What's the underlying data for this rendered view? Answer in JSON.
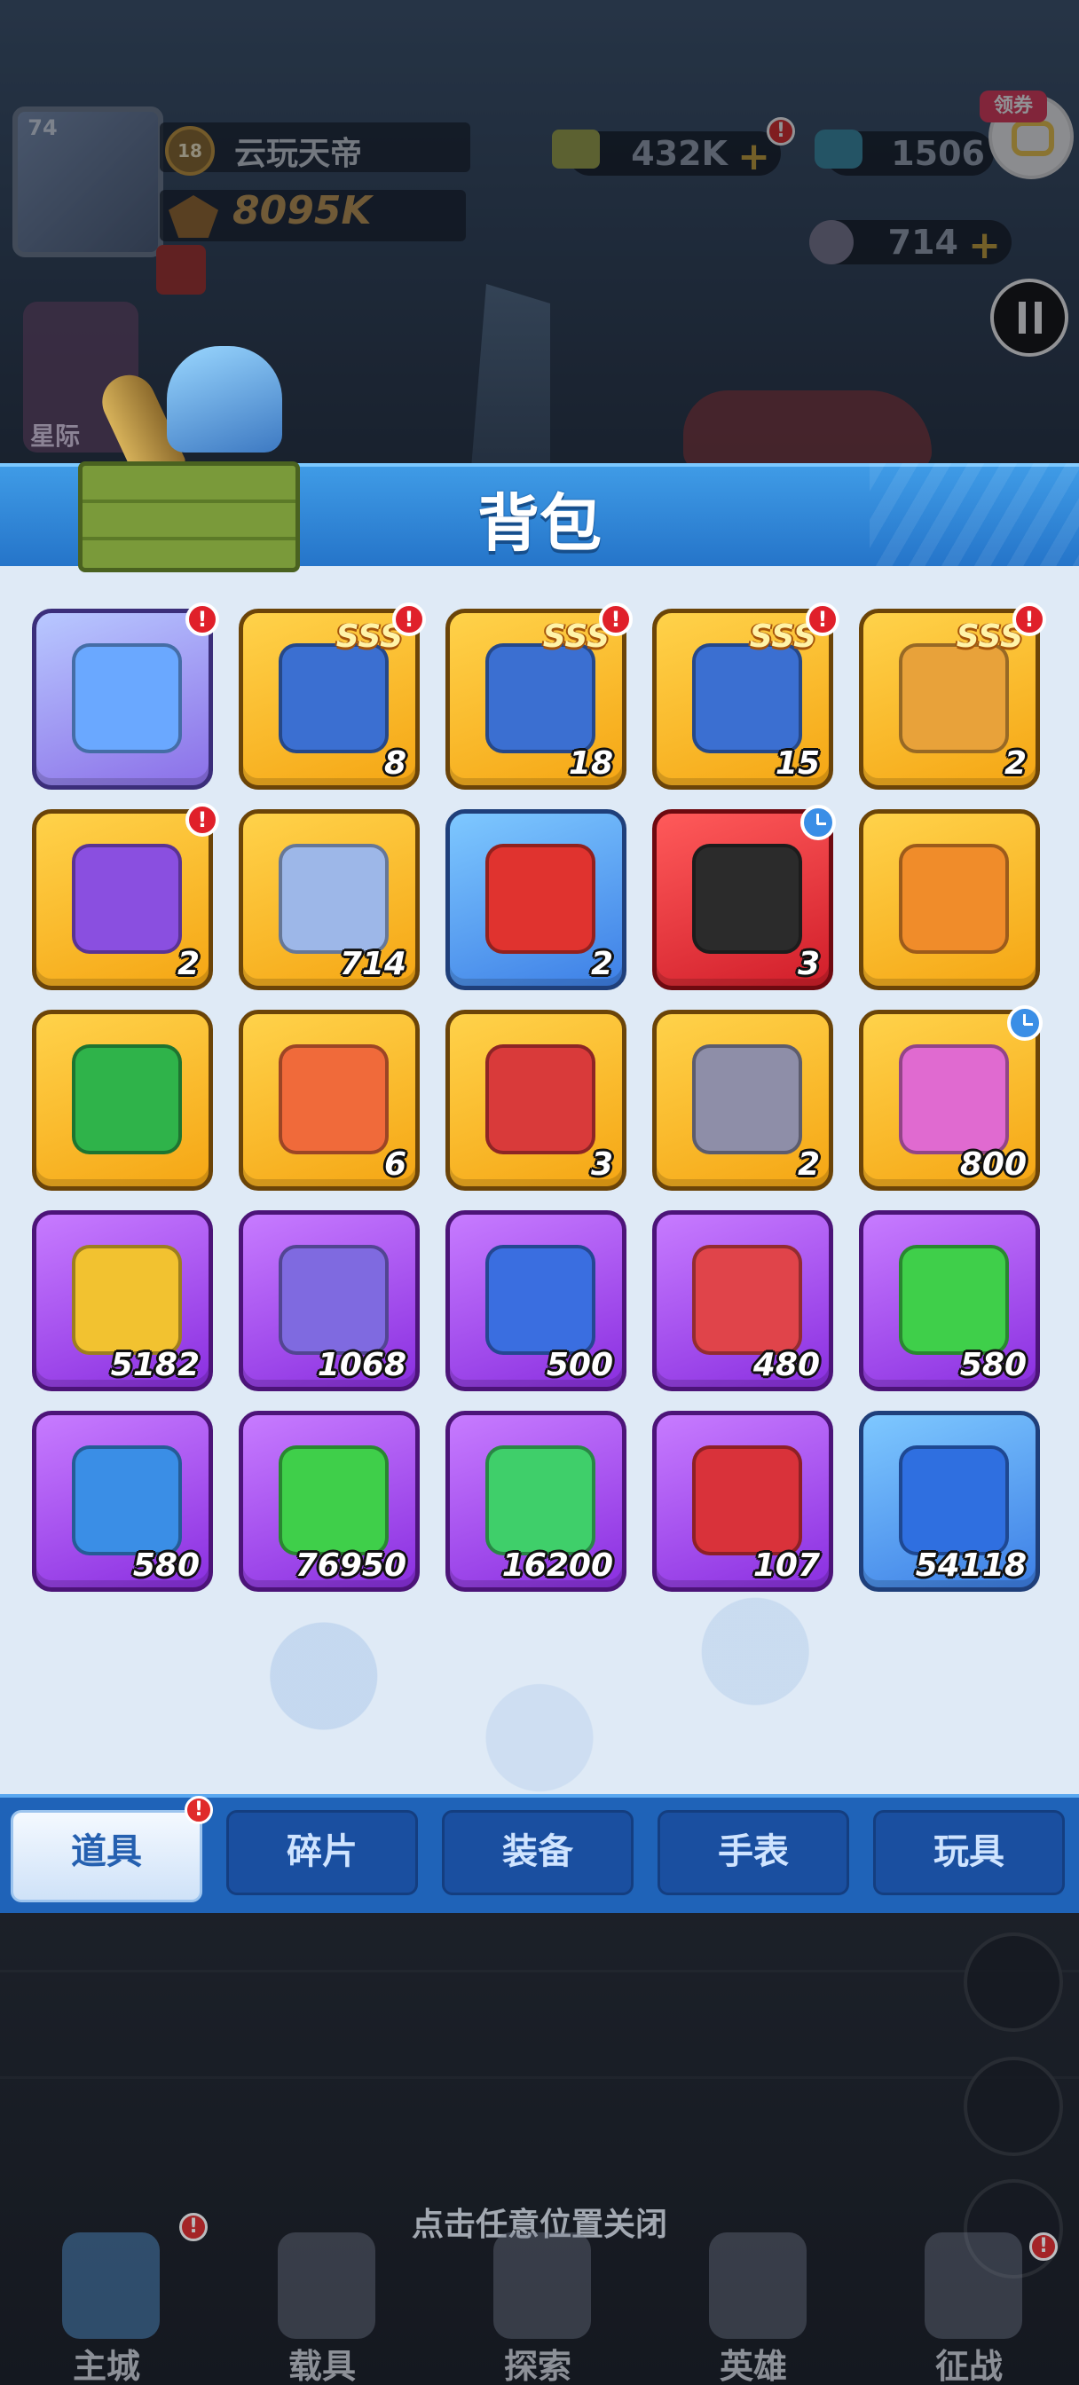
{
  "hud": {
    "avatar_level": "74",
    "rank_level": "18",
    "player_name": "云玩天帝",
    "power": "8095K",
    "star_button_label": "星际",
    "currency_gold": "432K",
    "currency_gems": "1506",
    "currency_b": "714",
    "coupon_label": "领券",
    "alert_mark": "!"
  },
  "modal": {
    "title": "背包",
    "sss_label": "SSS",
    "items": [
      {
        "count": "",
        "color": "lav",
        "icon": "chest-icon",
        "alert": true,
        "sss": false,
        "clock": false,
        "icon_color": "#6aa8ff"
      },
      {
        "count": "8",
        "color": "gold",
        "icon": "sss-card-icon",
        "alert": true,
        "sss": true,
        "clock": false,
        "icon_color": "#3b6fd1"
      },
      {
        "count": "18",
        "color": "gold",
        "icon": "sss-card-icon",
        "alert": true,
        "sss": true,
        "clock": false,
        "icon_color": "#3b6fd1"
      },
      {
        "count": "15",
        "color": "gold",
        "icon": "sss-card-icon",
        "alert": true,
        "sss": true,
        "clock": false,
        "icon_color": "#3b6fd1"
      },
      {
        "count": "2",
        "color": "gold",
        "icon": "sss-hero-card-icon",
        "alert": true,
        "sss": true,
        "clock": false,
        "icon_color": "#e8a23a"
      },
      {
        "count": "2",
        "color": "gold",
        "icon": "purple-book-icon",
        "alert": true,
        "sss": false,
        "clock": false,
        "icon_color": "#8a4fe0"
      },
      {
        "count": "714",
        "color": "gold",
        "icon": "b-coin-icon",
        "alert": false,
        "sss": false,
        "clock": false,
        "icon_color": "#9db7e8"
      },
      {
        "count": "2",
        "color": "blue",
        "icon": "red-ticket-icon",
        "alert": false,
        "sss": false,
        "clock": false,
        "icon_color": "#e0332f"
      },
      {
        "count": "3",
        "color": "red",
        "icon": "racing-helmet-icon",
        "alert": false,
        "sss": false,
        "clock": true,
        "icon_color": "#2b2b2b"
      },
      {
        "count": "",
        "color": "gold",
        "icon": "dna-book-icon",
        "alert": false,
        "sss": false,
        "clock": false,
        "icon_color": "#f08c2a"
      },
      {
        "count": "",
        "color": "gold",
        "icon": "green-book-icon",
        "alert": false,
        "sss": false,
        "clock": false,
        "icon_color": "#2fb34a"
      },
      {
        "count": "6",
        "color": "gold",
        "icon": "star-ticket-icon",
        "alert": false,
        "sss": false,
        "clock": false,
        "icon_color": "#f06a3a"
      },
      {
        "count": "3",
        "color": "gold",
        "icon": "red-gear-ticket-icon",
        "alert": false,
        "sss": false,
        "clock": false,
        "icon_color": "#d93a3a"
      },
      {
        "count": "2",
        "color": "gold",
        "icon": "engine-icon",
        "alert": false,
        "sss": false,
        "clock": false,
        "icon_color": "#8e8ea8"
      },
      {
        "count": "800",
        "color": "gold",
        "icon": "music-note-icon",
        "alert": false,
        "sss": false,
        "clock": true,
        "icon_color": "#e06ad0"
      },
      {
        "count": "5182",
        "color": "purple",
        "icon": "battery-icon",
        "alert": false,
        "sss": false,
        "clock": false,
        "icon_color": "#f2c230"
      },
      {
        "count": "1068",
        "color": "purple",
        "icon": "tool-card-icon",
        "alert": false,
        "sss": false,
        "clock": false,
        "icon_color": "#7f6ae0"
      },
      {
        "count": "500",
        "color": "purple",
        "icon": "hex-armor-icon",
        "alert": false,
        "sss": false,
        "clock": false,
        "icon_color": "#3a6ee0"
      },
      {
        "count": "480",
        "color": "purple",
        "icon": "red-badge-icon",
        "alert": false,
        "sss": false,
        "clock": false,
        "icon_color": "#e0444a"
      },
      {
        "count": "580",
        "color": "purple",
        "icon": "green-badge-icon",
        "alert": false,
        "sss": false,
        "clock": false,
        "icon_color": "#3fcf4a"
      },
      {
        "count": "580",
        "color": "purple",
        "icon": "blue-badge-icon",
        "alert": false,
        "sss": false,
        "clock": false,
        "icon_color": "#3a8ee6"
      },
      {
        "count": "76950",
        "color": "purple",
        "icon": "green-potion-icon",
        "alert": false,
        "sss": false,
        "clock": false,
        "icon_color": "#3fcf4a"
      },
      {
        "count": "16200",
        "color": "purple",
        "icon": "circuit-board-icon",
        "alert": false,
        "sss": false,
        "clock": false,
        "icon_color": "#3fcf6a"
      },
      {
        "count": "107",
        "color": "purple",
        "icon": "robot-part-icon",
        "alert": false,
        "sss": false,
        "clock": false,
        "icon_color": "#d9323a"
      },
      {
        "count": "54118",
        "color": "blue",
        "icon": "xp-can-icon",
        "alert": false,
        "sss": false,
        "clock": false,
        "icon_color": "#2f6fe0"
      }
    ]
  },
  "tabs": [
    {
      "label": "道具",
      "active": true,
      "alert": true
    },
    {
      "label": "碎片",
      "active": false,
      "alert": false
    },
    {
      "label": "装备",
      "active": false,
      "alert": false
    },
    {
      "label": "手表",
      "active": false,
      "alert": false
    },
    {
      "label": "玩具",
      "active": false,
      "alert": false
    }
  ],
  "close_hint": "点击任意位置关闭",
  "nav": [
    {
      "label": "主城",
      "icon": "main-city-icon"
    },
    {
      "label": "载具",
      "icon": "vehicle-icon"
    },
    {
      "label": "探索",
      "icon": "explore-icon"
    },
    {
      "label": "英雄",
      "icon": "hero-icon"
    },
    {
      "label": "征战",
      "icon": "campaign-icon"
    }
  ]
}
